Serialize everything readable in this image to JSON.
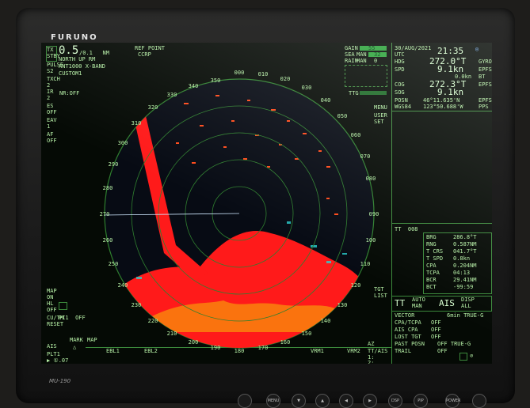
{
  "brand": "FURUNO",
  "model": "MU-190",
  "colors": {
    "echo_red": "#ff1a1a",
    "echo_yellow": "#f5e000",
    "echo_cyan": "#2ad0d0",
    "ring": "#2f7f2f",
    "text": "#b6f0a6"
  },
  "left_panel": {
    "tx_stby": "TX\nSTBY",
    "range": "0.5",
    "range_unit": "/0.1   NM",
    "pulse": "PULSE\nS2",
    "orientation": "NORTH UP RM",
    "antenna": "ANT1000 X-BAND",
    "custom": "CUSTOM1",
    "txch": "TXCH\n2",
    "ir": "IR\n2",
    "nr": "NR:OFF",
    "es": "ES\nOFF",
    "eav": "EAV\n1",
    "af": "AF\nOFF",
    "map": "MAP\nON",
    "hl": "HL\nOFF",
    "pi": "PI1  OFF",
    "cu": "CU/TM\nRESET",
    "ais": "AIS",
    "plt": "PLT1\n▶ ①.07",
    "mark": "MARK",
    "mark_map": "MAP"
  },
  "top_center": {
    "ref_point": "REF POINT",
    "ccrp": "CCRP"
  },
  "gain": {
    "gain_label": "GAIN",
    "gain_val": "55",
    "sea_label": "SEA",
    "sea_mode": "MAN",
    "sea_val": "32",
    "rain_label": "RAIN",
    "rain_mode": "MAN",
    "rain_val": "0"
  },
  "ttg": "TTG",
  "nav": {
    "date": "30/AUG/2021",
    "utc": "UTC",
    "time": "21:35",
    "hdg_label": "HDG",
    "hdg": "272.0°T",
    "hdg_src": "GYRO",
    "spd_label": "SPD",
    "spd": "9.1kn",
    "spd_src": "EPFS1",
    "stw": "0.0kn",
    "stw_src": "BT",
    "cog_label": "COG",
    "cog": "272.3°T",
    "cog_src": "EPFS1",
    "sog_label": "SOG",
    "sog": "9.1kn",
    "posn_label": "POSN",
    "lat": "46°11.635'N",
    "lon": "123°50.688'W",
    "posn_src": "EPFS1",
    "datum": "WGS84",
    "pps": "PPS"
  },
  "menu": {
    "menu": "MENU",
    "user": "USER\nSET"
  },
  "target": {
    "tt": "TT  008",
    "rows": [
      [
        "BRG",
        "286.8°T"
      ],
      [
        "RNG",
        "0.587NM"
      ],
      [
        "T CRS",
        "041.7°T"
      ],
      [
        "T SPD",
        "0.8kn"
      ],
      [
        "CPA",
        "0.204NM"
      ],
      [
        "TCPA",
        "04:13"
      ],
      [
        "BCR",
        "29.41NM"
      ],
      [
        "BCT",
        "-99:59"
      ]
    ]
  },
  "tgt_list": "TGT\nLIST",
  "tt_ais": {
    "tt": "TT",
    "auto": "AUTO\nMAN",
    "ais": "AIS",
    "disp": "DISP\nALL"
  },
  "settings": [
    [
      "VECTOR",
      "6min TRUE-G"
    ],
    [
      "CPA/TCPA",
      "OFF"
    ],
    [
      "AIS CPA",
      "OFF"
    ],
    [
      "LOST TGT",
      "OFF"
    ],
    [
      "PAST POSN",
      "OFF TRUE-G"
    ],
    [
      "TRAIL",
      "OFF"
    ]
  ],
  "bottom": {
    "ebl1": "EBL1",
    "ebl2": "EBL2",
    "vrm1": "VRM1",
    "vrm2": "VRM2",
    "az": "AZ",
    "ttais": "TT/AIS",
    "one": "1:",
    "two": "2:"
  },
  "bearings": {
    "b000": "000",
    "b010": "010",
    "b020": "020",
    "b030": "030",
    "b040": "040",
    "b050": "050",
    "b060": "060",
    "b070": "070",
    "b080": "080",
    "b090": "090",
    "b100": "100",
    "b110": "110",
    "b120": "120",
    "b130": "130",
    "b140": "140",
    "b150": "150",
    "b160": "160",
    "b170": "170",
    "b180": "180",
    "b190": "190",
    "b200": "200",
    "b210": "210",
    "b220": "220",
    "b230": "230",
    "b240": "240",
    "b250": "250",
    "b260": "260",
    "b270": "270",
    "b280": "280",
    "b290": "290",
    "b300": "300",
    "b310": "310",
    "b320": "320",
    "b330": "330",
    "b340": "340",
    "b350": "350"
  },
  "front_buttons": [
    "MENU",
    "▼",
    "▲",
    "◀",
    "▶",
    "DSP",
    "PIP",
    "POWER"
  ]
}
